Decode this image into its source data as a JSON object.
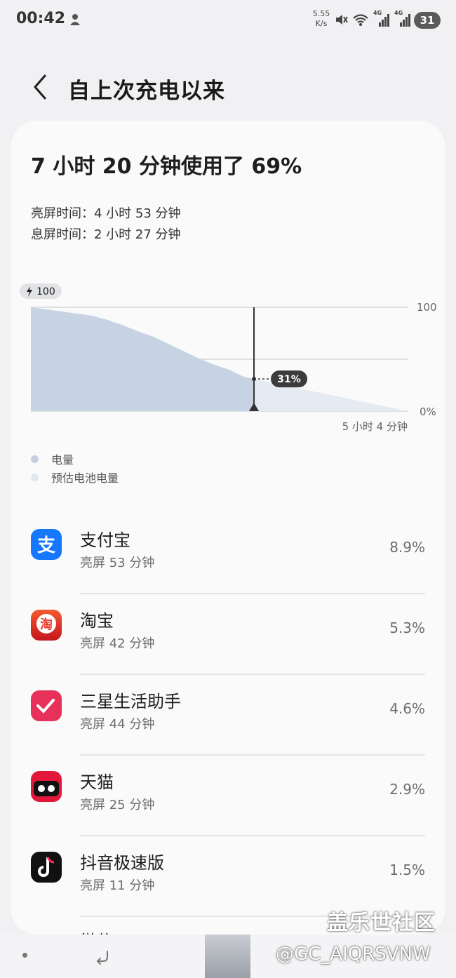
{
  "status_bar": {
    "time": "00:42",
    "speed": "5.55",
    "speed_unit": "K/s",
    "net1": "4G",
    "net2": "4G",
    "battery": "31"
  },
  "header": {
    "title": "自上次充电以来"
  },
  "summary": {
    "title": "7 小时 20 分钟使用了 69%",
    "screen_on": "亮屏时间：4 小时 53 分钟",
    "screen_off": "息屏时间：2 小时 27 分钟"
  },
  "chart": {
    "start_badge": "100",
    "y_top_label": "100",
    "y_bottom_label": "0%",
    "current_label": "31%",
    "remaining_label": "5 小时 4 分钟",
    "colors": {
      "actual": "#c7d3e3",
      "estimated": "#e6ebf3",
      "grid": "#d8d8dc"
    },
    "legend": [
      {
        "label": "电量",
        "color": "#c3cfdf"
      },
      {
        "label": "预估电池电量",
        "color": "#e3e8f0"
      }
    ]
  },
  "chart_data": {
    "type": "area",
    "ylim": [
      0,
      100
    ],
    "xlabel": "",
    "ylabel": "",
    "series": [
      {
        "name": "电量",
        "x_hours": [
          0,
          0.5,
          1,
          1.5,
          2,
          2.5,
          3,
          3.5,
          4,
          4.5,
          5,
          5.5,
          6,
          6.5,
          7,
          7.33
        ],
        "values": [
          100,
          98,
          96,
          94,
          92,
          88,
          83,
          77,
          72,
          65,
          58,
          51,
          45,
          40,
          33,
          31
        ]
      },
      {
        "name": "预估电池电量",
        "x_hours": [
          7.33,
          12.4
        ],
        "values": [
          31,
          0
        ]
      }
    ],
    "grid": true
  },
  "apps": [
    {
      "name": "支付宝",
      "sub": "亮屏 53 分钟",
      "pct": "8.9%",
      "icon": "alipay-icon",
      "color": "#1677ff"
    },
    {
      "name": "淘宝",
      "sub": "亮屏 42 分钟",
      "pct": "5.3%",
      "icon": "taobao-icon",
      "color": "#e8372c"
    },
    {
      "name": "三星生活助手",
      "sub": "亮屏 44 分钟",
      "pct": "4.6%",
      "icon": "samsung-assistant-icon",
      "color": "#e8315a"
    },
    {
      "name": "天猫",
      "sub": "亮屏 25 分钟",
      "pct": "2.9%",
      "icon": "tmall-icon",
      "color": "#e3173a"
    },
    {
      "name": "抖音极速版",
      "sub": "亮屏 11 分钟",
      "pct": "1.5%",
      "icon": "douyin-lite-icon",
      "color": "#111111"
    }
  ],
  "partial_app_name": "微信",
  "watermark": {
    "title": "盖乐世社区",
    "handle": "@GC_AIQRSVNW"
  }
}
